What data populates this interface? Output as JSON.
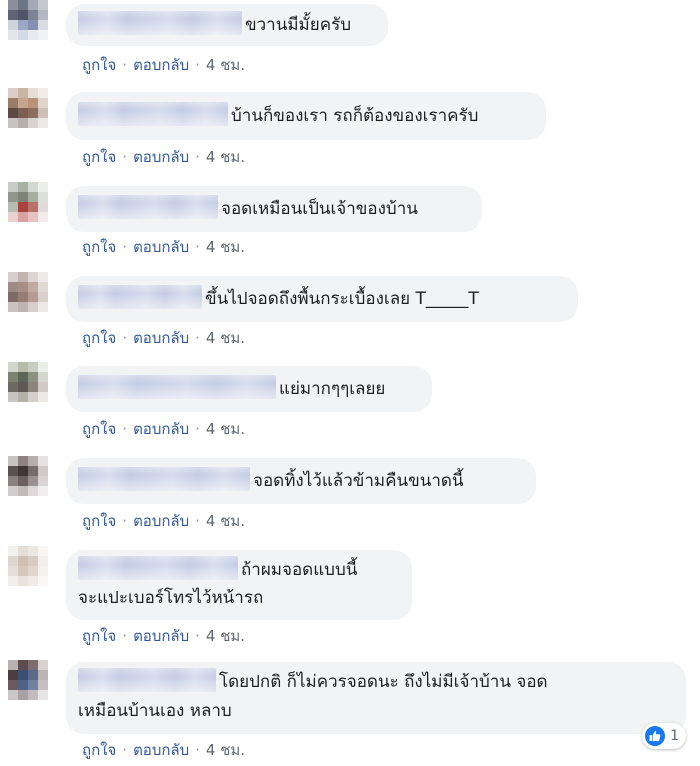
{
  "actions": {
    "like": "ถูกใจ",
    "reply": "ตอบกลับ",
    "separator": "·",
    "time": "4 ชม."
  },
  "comments": [
    {
      "lines": [
        "ขวานมีมั้ยครับ"
      ]
    },
    {
      "lines": [
        "บ้านก็ของเรา รถก็ต้องของเราครับ"
      ]
    },
    {
      "lines": [
        "จอดเหมือนเป็นเจ้าของบ้าน"
      ]
    },
    {
      "lines": [
        "ขึ้นไปจอดถึงพื้นกระเบื้องเลย T_____T"
      ]
    },
    {
      "lines": [
        "แย่มากๆๆเลยย"
      ]
    },
    {
      "lines": [
        "จอดทิ้งไว้แล้วข้ามคืนขนาดนี้"
      ]
    },
    {
      "lines": [
        "ถ้าผมจอดแบบนี้",
        "จะแปะเบอร์โทรไว้หน้ารถ"
      ]
    },
    {
      "lines": [
        "โดยปกติ ก็ไม่ควรจอดนะ ถึงไม่มีเจ้าบ้าน จอด",
        "เหมือนบ้านเอง หลาบ"
      ],
      "reaction_count": "1"
    }
  ],
  "colors": {
    "bubble": "#f2f3f5",
    "link": "#365899",
    "meta": "#606770",
    "like": "#1877f2"
  }
}
